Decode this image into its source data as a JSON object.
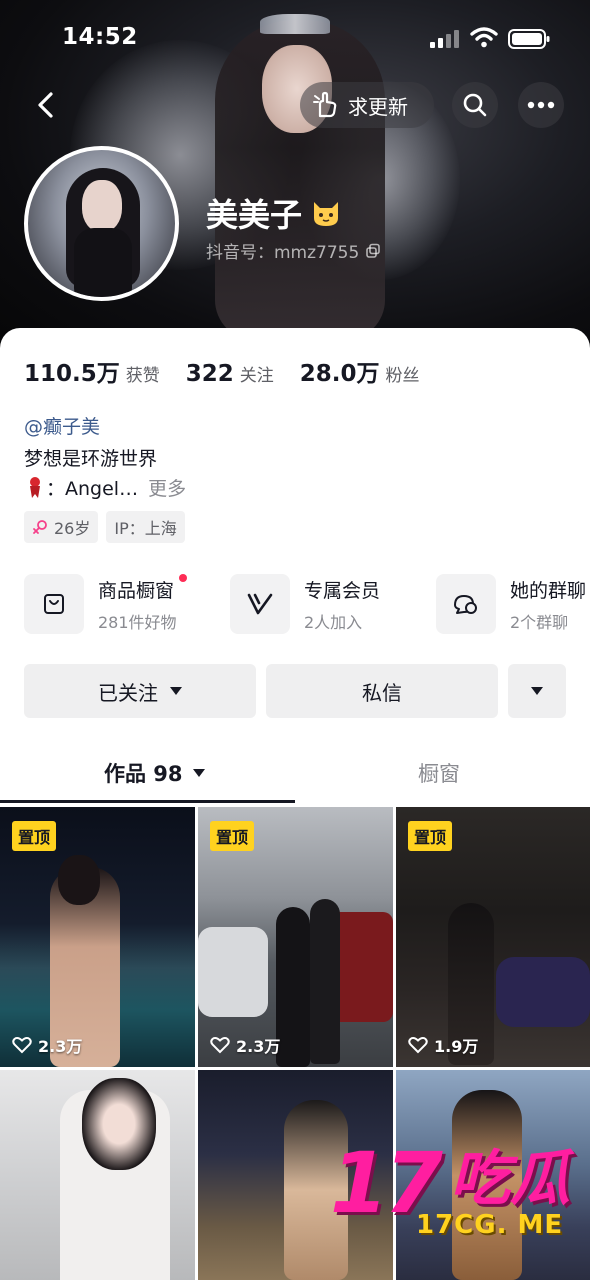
{
  "status_bar": {
    "time": "14:52"
  },
  "topbar": {
    "update_label": "求更新"
  },
  "profile": {
    "nickname": "美美子",
    "douyin_id": "抖音号：mmz7755",
    "stats": [
      {
        "value": "110.5万",
        "label": "获赞"
      },
      {
        "value": "322",
        "label": "关注"
      },
      {
        "value": "28.0万",
        "label": "粉丝"
      }
    ],
    "mention": "@癫子美",
    "motto": "梦想是环游世界",
    "desc_line": "：Angel…",
    "more_label": "更多",
    "tags": {
      "age": "26岁",
      "ip": "IP：上海"
    }
  },
  "entries": [
    {
      "title": "商品橱窗",
      "subtitle": "281件好物",
      "icon": "bag-icon"
    },
    {
      "title": "专属会员",
      "subtitle": "2人加入",
      "icon": "v-icon"
    },
    {
      "title": "她的群聊",
      "subtitle": "2个群聊",
      "icon": "chat-icon"
    }
  ],
  "actions": {
    "follow_label": "已关注",
    "message_label": "私信"
  },
  "tabs": {
    "works_label": "作品 98",
    "showcase_label": "橱窗"
  },
  "videos": [
    {
      "pinned_label": "置顶",
      "likes": "2.3万"
    },
    {
      "pinned_label": "置顶",
      "likes": "2.3万"
    },
    {
      "pinned_label": "置顶",
      "likes": "1.9万"
    },
    {
      "pinned_label": "",
      "likes": ""
    },
    {
      "pinned_label": "",
      "likes": ""
    },
    {
      "pinned_label": "",
      "likes": ""
    }
  ],
  "watermark": {
    "big": "17",
    "cn": "吃瓜",
    "url": "17CG. ME"
  }
}
